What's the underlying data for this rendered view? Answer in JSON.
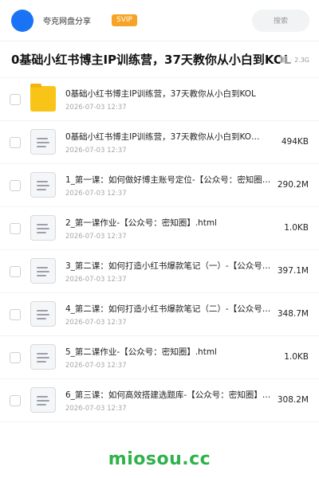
{
  "header": {
    "share_title": "夸克网盘分享",
    "svip_badge": "SVIP",
    "search_label": "搜索"
  },
  "folder": {
    "title": "0基础小红书博主IP训练营，37天教你从小白到KOL",
    "meta": "目 · 2.3G"
  },
  "files": [
    {
      "type": "folder",
      "name": "0基础小红书博主IP训练营，37天教你从小白到KOL",
      "date": "2026-07-03 12:37",
      "size": ""
    },
    {
      "type": "file",
      "name": "0基础小红书博主IP训练营，37天教你从小白到KO…",
      "date": "2026-07-03 12:37",
      "size": "494KB"
    },
    {
      "type": "file",
      "name": "1_第一课：如何做好博主账号定位-【公众号：密知圈…",
      "date": "2026-07-03 12:37",
      "size": "290.2M"
    },
    {
      "type": "file",
      "name": "2_第一课作业-【公众号：密知圈】.html",
      "date": "2026-07-03 12:37",
      "size": "1.0KB"
    },
    {
      "type": "file",
      "name": "3_第二课：如何打造小红书爆款笔记（一）-【公众号…",
      "date": "2026-07-03 12:37",
      "size": "397.1M"
    },
    {
      "type": "file",
      "name": "4_第二课：如何打造小红书爆款笔记（二）-【公众号…",
      "date": "2026-07-03 12:37",
      "size": "348.7M"
    },
    {
      "type": "file",
      "name": "5_第二课作业-【公众号：密知圈】.html",
      "date": "2026-07-03 12:37",
      "size": "1.0KB"
    },
    {
      "type": "file",
      "name": "6_第三课：如何高效搭建选题库-【公众号：密知圈】…",
      "date": "2026-07-03 12:37",
      "size": "308.2M"
    }
  ],
  "watermark": "miosou.cc",
  "colors": {
    "avatar": "#1a73f5",
    "svip": "#f7a325",
    "folder": "#f9c418",
    "watermark": "#2fb24a"
  }
}
